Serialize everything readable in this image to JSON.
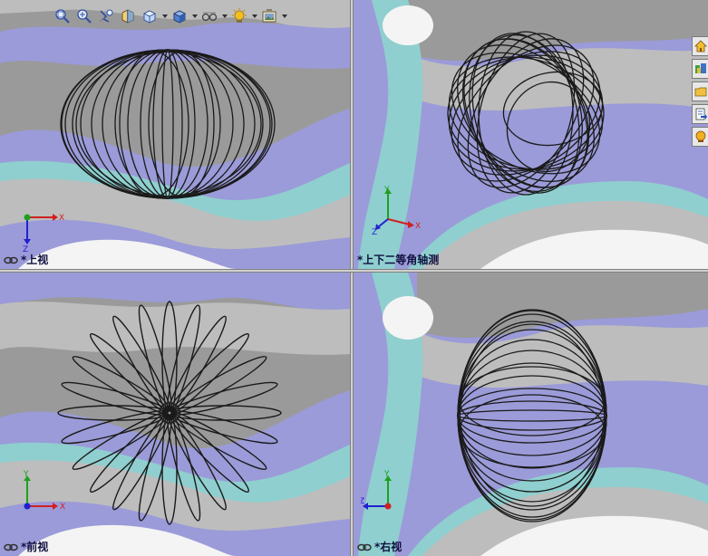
{
  "toolbar": {
    "buttons": [
      {
        "name": "zoom-to-fit",
        "icon": "zoom-fit-icon"
      },
      {
        "name": "zoom-to-area",
        "icon": "zoom-area-icon"
      },
      {
        "name": "previous-view",
        "icon": "previous-view-icon"
      },
      {
        "name": "section-view",
        "icon": "section-view-icon"
      },
      {
        "name": "view-orientation",
        "icon": "view-orientation-icon",
        "dropdown": true
      },
      {
        "name": "display-style",
        "icon": "display-style-icon",
        "dropdown": true
      },
      {
        "name": "hide-show-items",
        "icon": "hide-show-icon",
        "dropdown": true
      },
      {
        "name": "edit-appearance",
        "icon": "lighting-icon",
        "dropdown": true
      },
      {
        "name": "apply-scene",
        "icon": "scene-icon",
        "dropdown": true
      }
    ]
  },
  "viewports": [
    {
      "id": "top",
      "label": "*上视",
      "triad": {
        "h": "X",
        "v": "Z"
      }
    },
    {
      "id": "dimetric",
      "label": "*上下二等角轴测",
      "triad": {
        "h": "X",
        "v": "Y",
        "d": "Z"
      }
    },
    {
      "id": "front",
      "label": "*前视",
      "triad": {
        "h": "X",
        "v": "Y"
      }
    },
    {
      "id": "right",
      "label": "*右视",
      "triad": {
        "h": "Z",
        "v": "Y"
      }
    }
  ],
  "taskpane": {
    "tabs": [
      {
        "icon": "home-icon"
      },
      {
        "icon": "design-library-icon"
      },
      {
        "icon": "file-explorer-icon"
      },
      {
        "icon": "view-palette-icon"
      },
      {
        "icon": "appearances-icon"
      }
    ]
  },
  "colors": {
    "bg_gray": "#9a9a9a",
    "bg_purple": "#9b9bd9",
    "bg_teal": "#8fcfcf",
    "bg_white": "#f4f4f4",
    "bg_lightgray": "#bdbdbd",
    "model_stroke": "#1a1a1a",
    "axis_x": "#d22020",
    "axis_y": "#20a020",
    "axis_z": "#2020d0"
  }
}
